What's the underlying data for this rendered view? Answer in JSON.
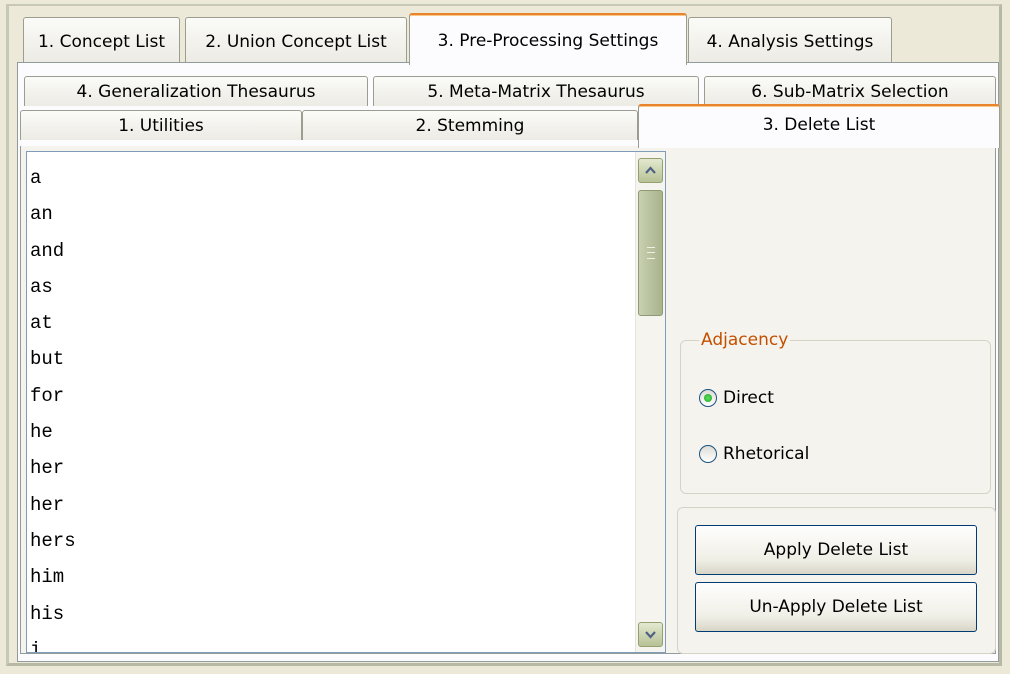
{
  "top_tabs": [
    {
      "label": "1. Concept List"
    },
    {
      "label": "2. Union Concept List"
    },
    {
      "label": "3. Pre-Processing Settings"
    },
    {
      "label": "4. Analysis Settings"
    }
  ],
  "sub_tabs_back_row": [
    {
      "label": "4. Generalization Thesaurus"
    },
    {
      "label": "5. Meta-Matrix Thesaurus"
    },
    {
      "label": "6. Sub-Matrix Selection"
    }
  ],
  "sub_tabs_front_row": [
    {
      "label": "1. Utilities"
    },
    {
      "label": "2. Stemming"
    },
    {
      "label": "3. Delete List"
    }
  ],
  "delete_list": {
    "items": [
      "a",
      "an",
      "and",
      "as",
      "at",
      "but",
      "for",
      "he",
      "her",
      "her",
      "hers",
      "him",
      "his",
      "i"
    ]
  },
  "adjacency": {
    "legend": "Adjacency",
    "options": [
      {
        "label": "Direct",
        "selected": true
      },
      {
        "label": "Rhetorical",
        "selected": false
      }
    ]
  },
  "actions": {
    "apply_label": "Apply Delete List",
    "unapply_label": "Un-Apply Delete List"
  },
  "colors": {
    "selected_tab_accent": "#e9842c",
    "group_legend": "#c35000",
    "radio_dot": "#21a121"
  }
}
